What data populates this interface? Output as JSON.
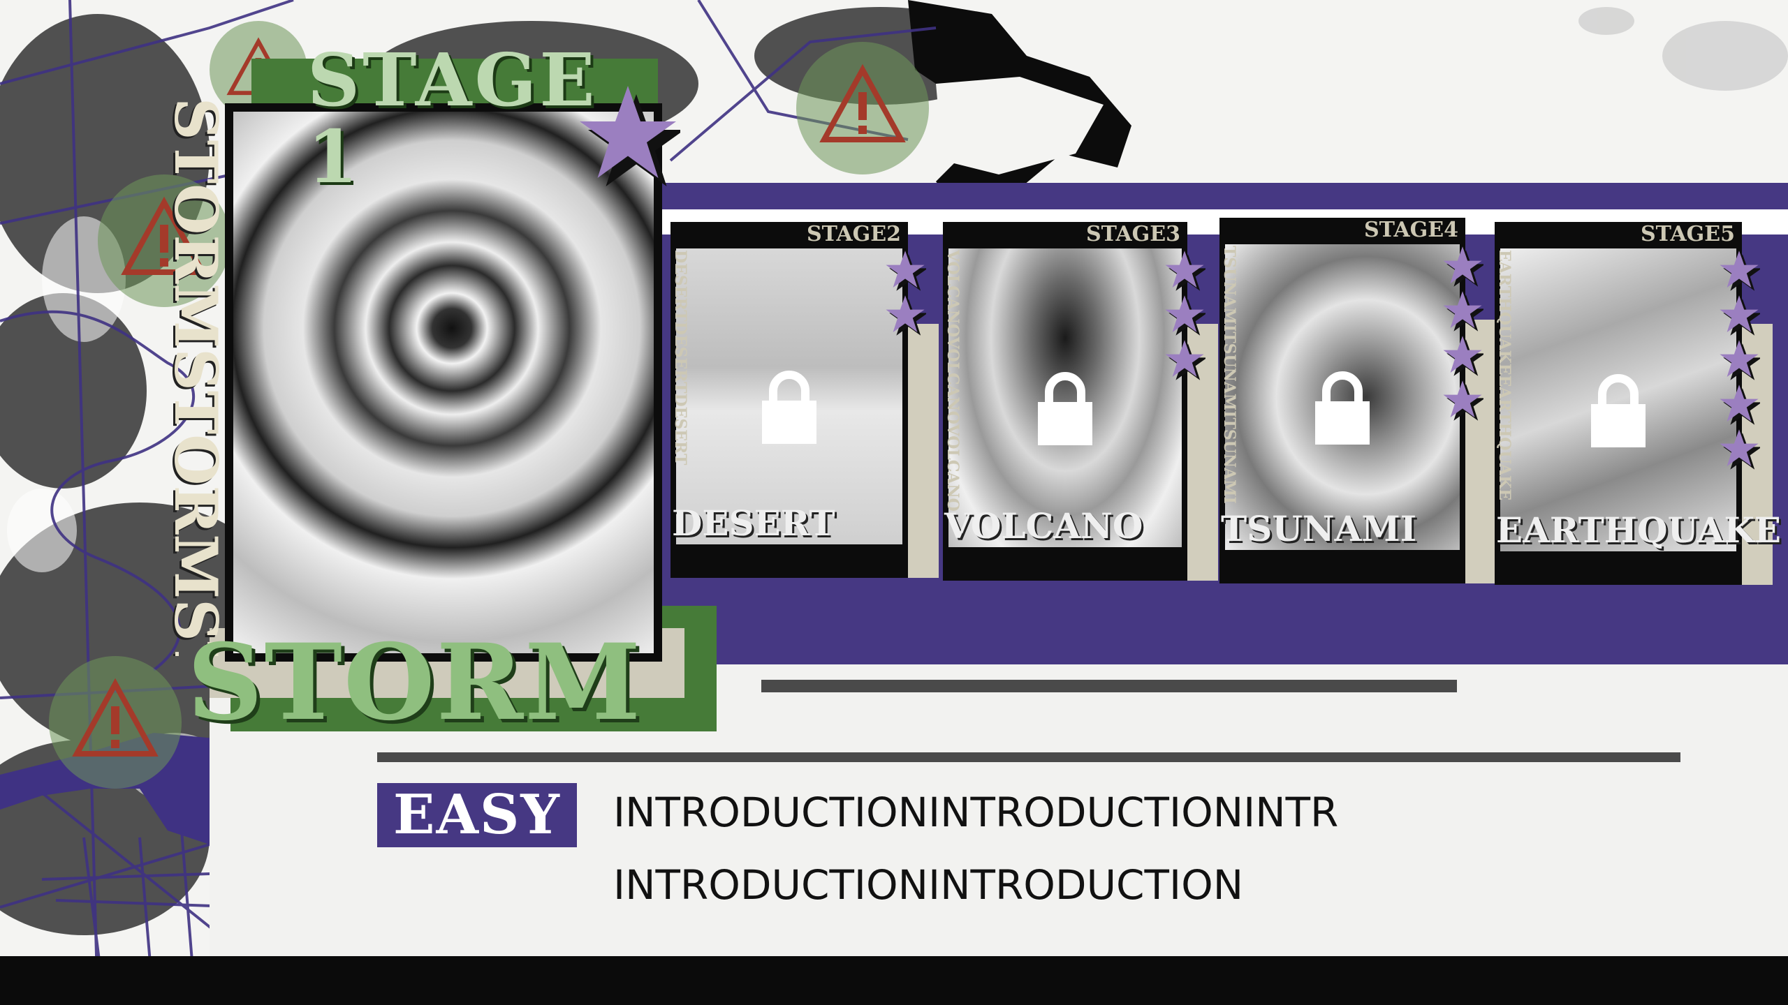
{
  "colors": {
    "purple": "#463883",
    "green": "#467b38",
    "light_green": "#8fbf7f",
    "beige": "#d2cebd",
    "star": "#9b7fc0",
    "warning_red": "#a43a2a"
  },
  "stage1": {
    "title": "STAGE 1",
    "name": "STORM",
    "side_text": "STORMSTORMSTORM",
    "star_icon": "star-icon"
  },
  "stages": [
    {
      "tag": "STAGE2",
      "name": "DESERT",
      "side_text": "DESERTDESERTDESERT",
      "stars": 2,
      "locked": true
    },
    {
      "tag": "STAGE3",
      "name": "VOLCANO",
      "side_text": "VOLCANOVOLCANOVOLCANO",
      "stars": 3,
      "locked": true
    },
    {
      "tag": "STAGE4",
      "name": "TSUNAMI",
      "side_text": "TSUNAMITSUNAMITSUNAMI",
      "stars": 4,
      "locked": true
    },
    {
      "tag": "STAGE5",
      "name": "EARTHQUAKE",
      "side_text": "EARTHQUAKEEARTHQUAKE",
      "stars": 5,
      "locked": true
    }
  ],
  "difficulty": "EASY",
  "intro": {
    "line1": "INTRODUCTIONINTRODUCTIONINTR",
    "line2": "INTRODUCTIONINTRODUCTION"
  },
  "icons": [
    "warning-icon",
    "lock-icon",
    "star-icon"
  ]
}
